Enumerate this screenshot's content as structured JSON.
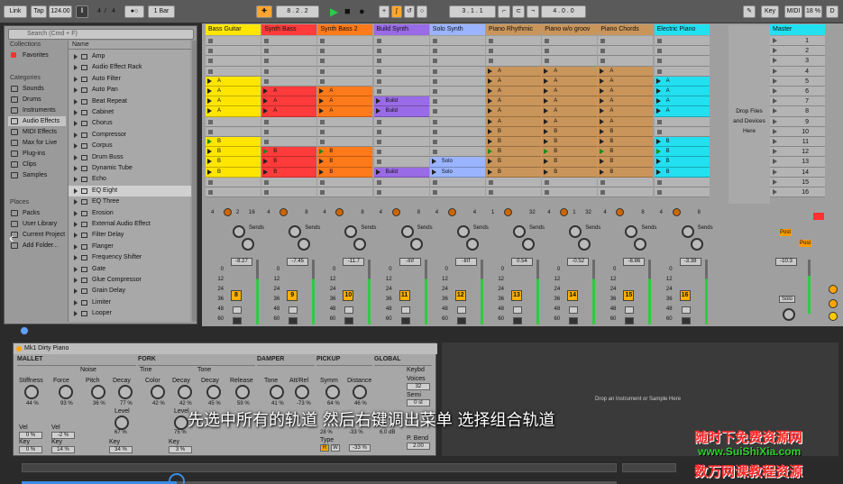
{
  "transport": {
    "link": "Link",
    "tap": "Tap",
    "tempo": "124.00",
    "sig_num": "4",
    "sig_den": "4",
    "metro": "1 Bar",
    "position": "8 .  2 .  2",
    "loop_start": "3 .  1 .  1",
    "loop_length": "4 .  0 .  0",
    "key": "Key",
    "midi": "MIDI",
    "cpu": "18 %",
    "d": "D"
  },
  "browser": {
    "search_placeholder": "Search (Cmd + F)",
    "collections_label": "Collections",
    "favorites": "Favorites",
    "categories_label": "Categories",
    "categories": [
      "Sounds",
      "Drums",
      "Instruments",
      "Audio Effects",
      "MIDI Effects",
      "Max for Live",
      "Plug-ins",
      "Clips",
      "Samples"
    ],
    "places_label": "Places",
    "places": [
      "Packs",
      "User Library",
      "Current Project",
      "Add Folder..."
    ],
    "list_header": "Name",
    "items": [
      "Amp",
      "Audio Effect Rack",
      "Auto Filter",
      "Auto Pan",
      "Beat Repeat",
      "Cabinet",
      "Chorus",
      "Compressor",
      "Corpus",
      "Drum Buss",
      "Dynamic Tube",
      "Echo",
      "EQ Eight",
      "EQ Three",
      "Erosion",
      "External Audio Effect",
      "Filter Delay",
      "Flanger",
      "Frequency Shifter",
      "Gate",
      "Glue Compressor",
      "Grain Delay",
      "Limiter",
      "Looper"
    ]
  },
  "tracks": [
    {
      "name": "Bass Guitar",
      "color": "#ffe600",
      "num": "8",
      "vol": "-8.27",
      "c1": "4",
      "c2": "2",
      "c3": "16"
    },
    {
      "name": "Synth Bass",
      "color": "#ff3b3b",
      "num": "9",
      "vol": "-7.45",
      "c1": "4",
      "c2": "",
      "c3": "8"
    },
    {
      "name": "Synth Bass 2",
      "color": "#ff7a1a",
      "num": "10",
      "vol": "-11.7",
      "c1": "4",
      "c2": "",
      "c3": "8"
    },
    {
      "name": "Build Synth",
      "color": "#9a6be6",
      "num": "11",
      "vol": "-Inf",
      "c1": "4",
      "c2": "",
      "c3": "8"
    },
    {
      "name": "Solo Synth",
      "color": "#9ab4ff",
      "num": "12",
      "vol": "-Inf",
      "c1": "4",
      "c2": "",
      "c3": "4"
    },
    {
      "name": "Piano Rhythmic",
      "color": "#c9955a",
      "num": "13",
      "vol": "0.54",
      "c1": "1",
      "c2": "",
      "c3": "32"
    },
    {
      "name": "Piano w/o groov",
      "color": "#c9955a",
      "num": "14",
      "vol": "-0.52",
      "c1": "4",
      "c2": "1",
      "c3": "32"
    },
    {
      "name": "Piano Chords",
      "color": "#c9955a",
      "num": "15",
      "vol": "-8.86",
      "c1": "4",
      "c2": "",
      "c3": "8"
    },
    {
      "name": "Electric Piano",
      "color": "#22e0f0",
      "num": "16",
      "vol": "-3.38",
      "c1": "4",
      "c2": "",
      "c3": "8"
    }
  ],
  "clip_letter_a": "A",
  "clip_letter_b": "B",
  "clip_build": "Build",
  "clip_solo": "Solo",
  "drop_files": "Drop Files and Devices Here",
  "sends_label": "Sends",
  "scale_labels": [
    "0",
    "12",
    "24",
    "36",
    "48",
    "60"
  ],
  "master": {
    "name": "Master",
    "scenes": [
      "1",
      "2",
      "3",
      "4",
      "5",
      "6",
      "7",
      "8",
      "9",
      "10",
      "11",
      "12",
      "13",
      "14",
      "15",
      "16"
    ],
    "vol": "-10.3",
    "post1": "Post",
    "post2": "Post",
    "solo": "Solo"
  },
  "device": {
    "title": "Mk1 Dirty Piano",
    "sections": [
      "MALLET",
      "FORK",
      "DAMPER",
      "PICKUP",
      "GLOBAL"
    ],
    "params": [
      {
        "label": "Stiffness",
        "value": "44 %"
      },
      {
        "label": "Force",
        "value": "93 %"
      },
      {
        "label": "Pitch",
        "value": "36 %"
      },
      {
        "label": "Decay",
        "value": "77 %"
      },
      {
        "label": "Color",
        "value": "42 %"
      },
      {
        "label": "Decay",
        "value": "42 %"
      },
      {
        "label": "Decay",
        "value": "45 %"
      },
      {
        "label": "Release",
        "value": "59 %"
      },
      {
        "label": "Tone",
        "value": "41 %"
      },
      {
        "label": "Att/Rel",
        "value": "-73 %"
      },
      {
        "label": "Symm",
        "value": "64 %"
      },
      {
        "label": "Distance",
        "value": "46 %"
      }
    ],
    "sub_noise": "Noise",
    "sub_tine": "Tine",
    "sub_tone": "Tone",
    "level1_label": "Level",
    "level1_value": "67 %",
    "level2_label": "Level",
    "level2_value": "75 %",
    "vel_label": "Vel",
    "vel1": "0 %",
    "key_label": "Key",
    "key1": "0 %",
    "vel2": "-2 %",
    "key2": "14 %",
    "key3": "34 %",
    "key4": "3 %",
    "pick_vel": "28 %",
    "pick_key": "-33 %",
    "type_label": "Type",
    "type_r": "R",
    "type_w": "W",
    "keyb_label": "Keybd",
    "voices_label": "Voices",
    "voices": "32",
    "semi_label": "Semi",
    "semi": "0 st",
    "pbend_label": "P. Bend",
    "pbend": "2.00",
    "global_val": "6.0 dB"
  },
  "drop_instrument": "Drop an Instrument or Sample Here",
  "subtitle": "先选中所有的轨道 然后右键调出菜单 选择组合轨道",
  "watermark": {
    "line1": "随时下免费资源网",
    "line2": "www.SuiShiXia.com",
    "line3": "数万网课教程资源"
  },
  "progress": 0.26
}
